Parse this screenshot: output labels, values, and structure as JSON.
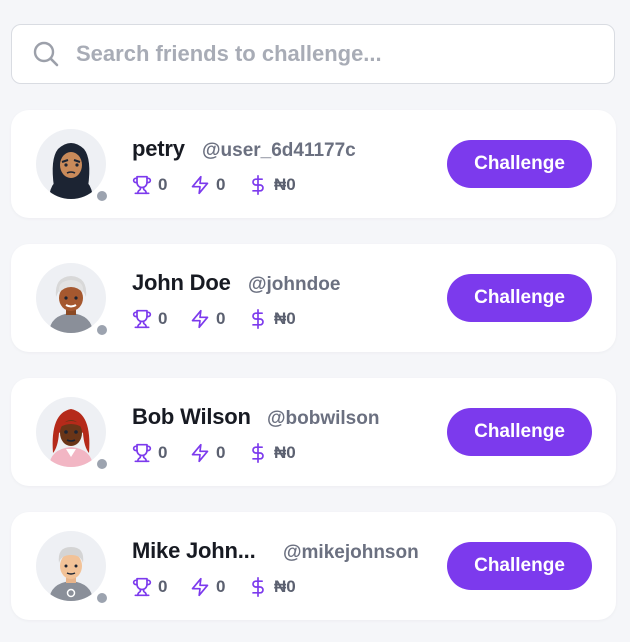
{
  "search": {
    "placeholder": "Search friends to challenge...",
    "icon": "search-icon"
  },
  "accent_color": "#7c3aed",
  "status_color": "#9ca3af",
  "friends": [
    {
      "name": "petry",
      "handle": "@user_6d41177c",
      "trophies": "0",
      "streak": "0",
      "money": "₦0",
      "status": "offline",
      "button": "Challenge"
    },
    {
      "name": "John Doe",
      "handle": "@johndoe",
      "trophies": "0",
      "streak": "0",
      "money": "₦0",
      "status": "offline",
      "button": "Challenge"
    },
    {
      "name": "Bob Wilson",
      "handle": "@bobwilson",
      "trophies": "0",
      "streak": "0",
      "money": "₦0",
      "status": "offline",
      "button": "Challenge"
    },
    {
      "name": "Mike John...",
      "handle": "@mikejohnson",
      "trophies": "0",
      "streak": "0",
      "money": "₦0",
      "status": "offline",
      "button": "Challenge"
    }
  ]
}
